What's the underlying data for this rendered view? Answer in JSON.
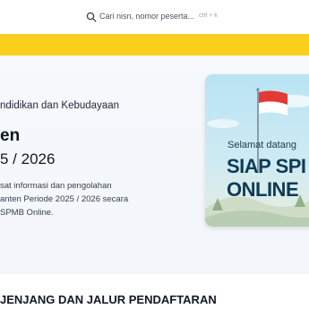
{
  "search": {
    "placeholder": "Cari nisn, nomor peserta...",
    "shortcut": "ctrl + k",
    "icon": "search-icon"
  },
  "hero": {
    "subtitle": "ndidikan dan Kebudayaan",
    "title_line1": "en",
    "title_line2": "5 / 2026",
    "description": [
      "sat informasi dan pengolahan",
      "anten Periode 2025 / 2026 secara",
      "SPMB Online."
    ]
  },
  "banner": {
    "greeting": "Selamat datang",
    "line1": "SIAP SPI",
    "line2": "ONLINE"
  },
  "section": {
    "title": "JENJANG DAN JALUR PENDAFTARAN"
  },
  "colors": {
    "accent_yellow": "#f9cf1c",
    "banner_text": "#0f3b57",
    "flag_red": "#e53935"
  }
}
